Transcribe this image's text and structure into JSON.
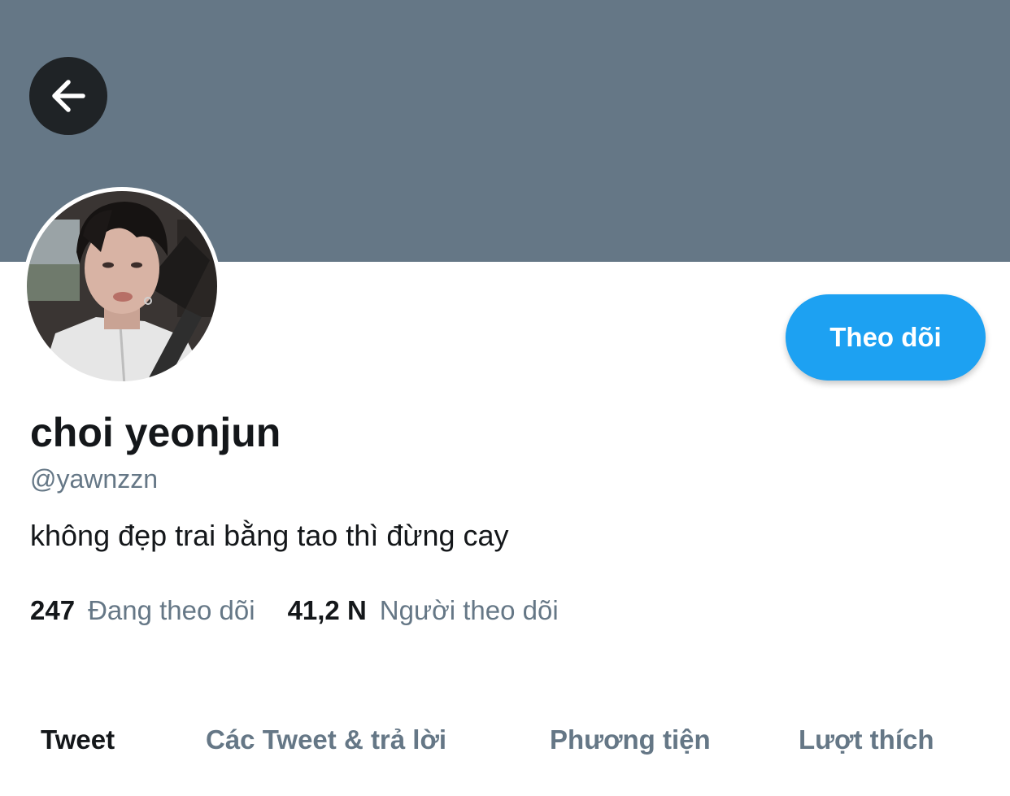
{
  "colors": {
    "banner": "#657786",
    "accent": "#1da1f2",
    "secondary_text": "#657786",
    "primary_text": "#14171a"
  },
  "header": {
    "back_icon": "arrow-left-icon"
  },
  "profile": {
    "avatar_icon": "profile-photo",
    "follow_label": "Theo dõi",
    "display_name": "choi yeonjun",
    "handle": "@yawnzzn",
    "bio": "không đẹp trai bằng tao thì đừng cay",
    "following_count": "247",
    "following_label": "Đang theo dõi",
    "followers_count": "41,2 N",
    "followers_label": "Người theo dõi"
  },
  "tabs": [
    {
      "label": "Tweet",
      "active": true
    },
    {
      "label": "Các Tweet & trả lời",
      "active": false
    },
    {
      "label": "Phương tiện",
      "active": false
    },
    {
      "label": "Lượt thích",
      "active": false
    }
  ]
}
